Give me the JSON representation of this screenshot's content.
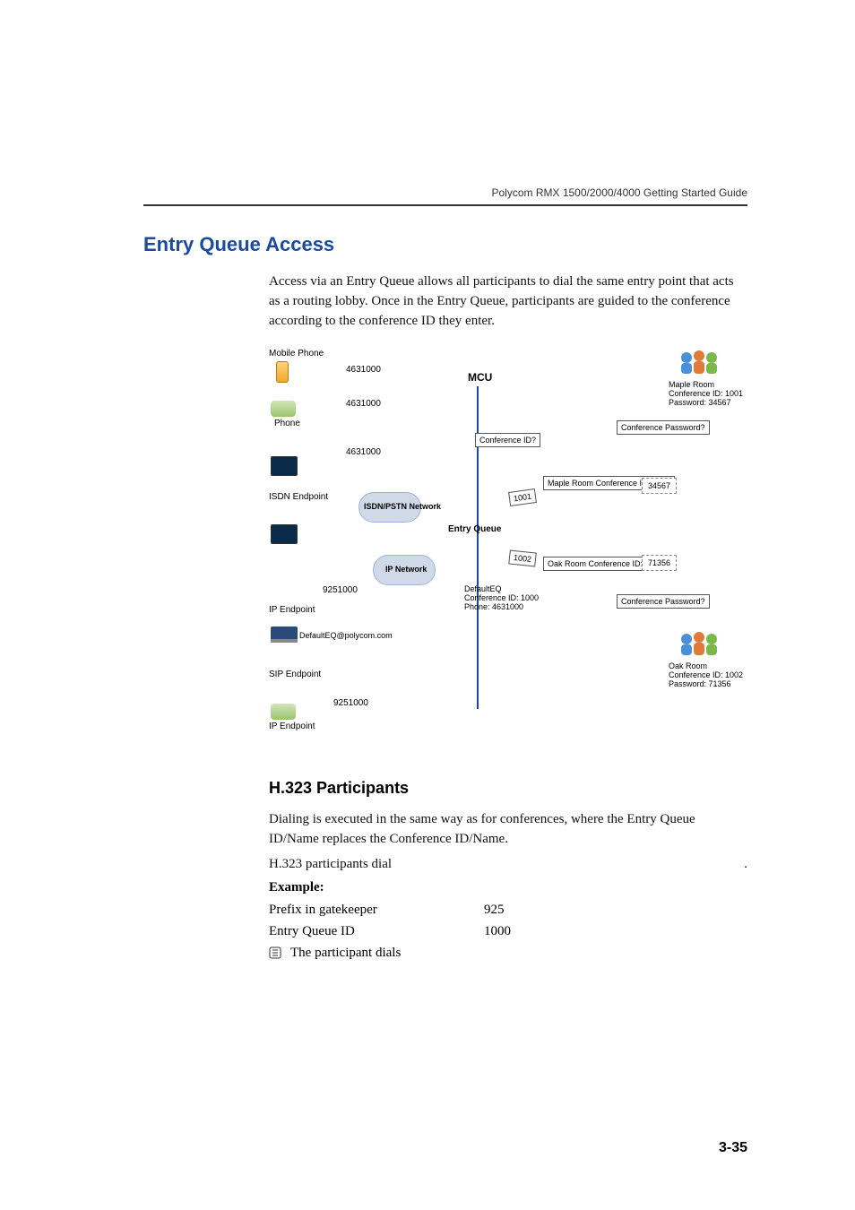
{
  "doc_header": "Polycom RMX 1500/2000/4000 Getting Started Guide",
  "section_title": "Entry Queue Access",
  "intro_paragraph": "Access via an Entry Queue allows all participants to dial the same entry point that acts as a routing lobby. Once in the Entry Queue, participants are guided to the conference according to the conference ID they enter.",
  "diagram": {
    "mobile_phone": "Mobile Phone",
    "phone": "Phone",
    "isdn_endpoint": "ISDN Endpoint",
    "ip_endpoint": "IP Endpoint",
    "sip_endpoint": "SIP Endpoint",
    "ip_endpoint2": "IP Endpoint",
    "dial1": "4631000",
    "dial2": "4631000",
    "dial3": "4631000",
    "dial4": "9251000",
    "dial5": "DefaultEQ@polycom.com",
    "dial6": "9251000",
    "isdn_network": "ISDN/PSTN Network",
    "ip_network": "IP Network",
    "mcu": "MCU",
    "entry_queue": "Entry Queue",
    "defaulteq_line1": "DefaultEQ",
    "defaulteq_line2": "Conference ID: 1000",
    "defaulteq_line3": "Phone: 4631000",
    "conf_id_prompt": "Conference ID?",
    "conf_pw_prompt1": "Conference Password?",
    "conf_pw_prompt2": "Conference Password?",
    "maple_bubble": "Maple Room Conference ID: 1001",
    "oak_bubble": "Oak Room Conference ID: 1002",
    "tag_1001": "1001",
    "tag_1002": "1002",
    "input_34567": "34567",
    "input_71356": "71356",
    "maple_room_line1": "Maple Room",
    "maple_room_line2": "Conference ID: 1001",
    "maple_room_line3": "Password: 34567",
    "oak_room_line1": "Oak Room",
    "oak_room_line2": "Conference ID: 1002",
    "oak_room_line3": "Password: 71356"
  },
  "subsection_title": "H.323 Participants",
  "h323_para": "Dialing is executed in the same way as for conferences, where the Entry Queue ID/Name replaces the Conference ID/Name.",
  "h323_dial_line": "H.323 participants dial",
  "example_label": "Example:",
  "rows": [
    {
      "k": "Prefix in gatekeeper",
      "v": "925"
    },
    {
      "k": "Entry Queue ID",
      "v": "1000"
    }
  ],
  "bullet": "The participant dials",
  "page_number": "3-35"
}
